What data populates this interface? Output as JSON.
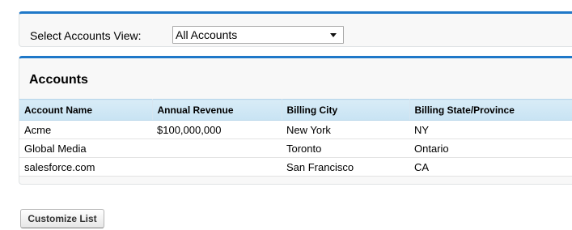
{
  "filter": {
    "label": "Select Accounts View:",
    "selected_view": "All Accounts"
  },
  "accounts": {
    "title": "Accounts",
    "columns": [
      "Account Name",
      "Annual Revenue",
      "Billing City",
      "Billing State/Province"
    ],
    "rows": [
      [
        "Acme",
        "$100,000,000",
        "New York",
        "NY"
      ],
      [
        "Global Media",
        "",
        "Toronto",
        "Ontario"
      ],
      [
        "salesforce.com",
        "",
        "San Francisco",
        "CA"
      ]
    ]
  },
  "actions": {
    "customize_label": "Customize List"
  },
  "colors": {
    "accent": "#1f78c8",
    "header_bg": "#d3e9f6"
  }
}
